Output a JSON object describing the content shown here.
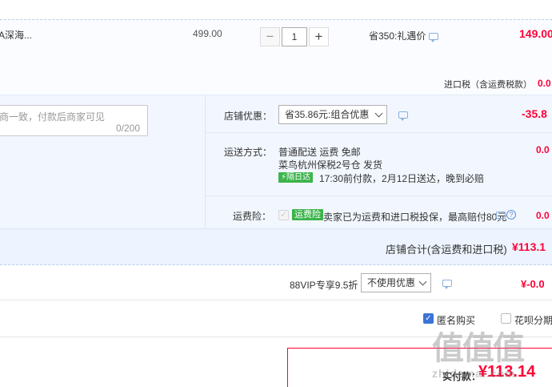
{
  "item": {
    "name_fragment": "A深海...",
    "unit_price": "499.00",
    "quantity_minus": "−",
    "quantity": "1",
    "quantity_plus": "+",
    "promo_text": "省350:礼遇价",
    "subtotal": "149.00",
    "import_tax_label": "进口税（含运费税款）",
    "import_tax_value": "0.0"
  },
  "message": {
    "placeholder": "商一致，付款后商家可见",
    "counter": "0/200"
  },
  "store_discount": {
    "label": "店铺优惠：",
    "selected": "省35.86元:组合优惠",
    "amount": "-35.8"
  },
  "shipping": {
    "label": "运送方式：",
    "method": "普通配送 运费 免邮",
    "warehouse": "菜鸟杭州保税2号仓  发货",
    "badge": "隔日达",
    "promise": "17:30前付款，2月12日送达，晚到必赔",
    "amount": "0.0"
  },
  "freight_insurance": {
    "label": "运费险：",
    "badge": "运费险",
    "text": "卖家已为运费和进口税投保，最高赔付80元",
    "amount": "0.0",
    "help_glyph": "?"
  },
  "store_total": {
    "label": "店铺合计(含运费和进口税)",
    "value": "¥113.1"
  },
  "platform_discount": {
    "label": "88VIP专享9.5折",
    "selected": "不使用优惠",
    "amount": "¥-0.0"
  },
  "options": {
    "anonymous": "匿名购买",
    "installment": "花呗分期"
  },
  "payment": {
    "label": "实付款：",
    "value": "¥113.14"
  },
  "watermark": {
    "line1": "值值值",
    "line2": "zhidemai.com"
  },
  "colors": {
    "price_red": "#ff0036",
    "tag_green": "#3cb44b",
    "checkbox_blue": "#3b73d8"
  },
  "icons": [
    "chat-bubble-icon",
    "help-icon",
    "check-icon",
    "chevron-down-icon"
  ]
}
